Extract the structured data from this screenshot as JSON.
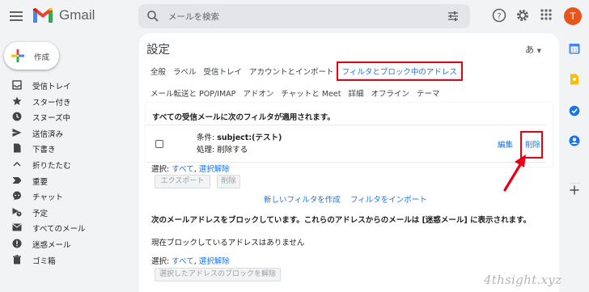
{
  "header": {
    "app_name": "Gmail",
    "search_placeholder": "メールを検索",
    "avatar_letter": "T"
  },
  "sidebar": {
    "compose_label": "作成",
    "items": [
      {
        "label": "受信トレイ",
        "icon": "inbox-icon"
      },
      {
        "label": "スター付き",
        "icon": "star-icon"
      },
      {
        "label": "スヌーズ中",
        "icon": "clock-icon"
      },
      {
        "label": "送信済み",
        "icon": "send-icon"
      },
      {
        "label": "下書き",
        "icon": "draft-icon"
      },
      {
        "label": "折りたたむ",
        "icon": "chevron-up-icon"
      },
      {
        "label": "重要",
        "icon": "important-icon"
      },
      {
        "label": "チャット",
        "icon": "chat-icon"
      },
      {
        "label": "予定",
        "icon": "scheduled-icon"
      },
      {
        "label": "すべてのメール",
        "icon": "all-mail-icon"
      },
      {
        "label": "迷惑メール",
        "icon": "spam-icon"
      },
      {
        "label": "ゴミ箱",
        "icon": "trash-icon"
      }
    ]
  },
  "settings": {
    "title": "設定",
    "input_tool": "あ",
    "tabs_row1": [
      "全般",
      "ラベル",
      "受信トレイ",
      "アカウントとインポート",
      "フィルタとブロック中のアドレス"
    ],
    "tabs_row2": [
      "メール転送と POP/IMAP",
      "アドオン",
      "チャットと Meet",
      "詳細",
      "オフライン",
      "テーマ"
    ],
    "filters_heading": "すべての受信メールに次のフィルタが適用されます。",
    "filter": {
      "condition_prefix": "条件: ",
      "condition_value": "subject:(テスト)",
      "action": "処理: 削除する",
      "edit": "編集",
      "delete": "削除"
    },
    "select_prefix": "選択: ",
    "select_all": "すべて",
    "select_sep": ", ",
    "select_none": "選択解除",
    "export_button": "エクスポート",
    "delete_button": "削除",
    "create_filter": "新しいフィルタを作成",
    "import_filter": "フィルタをインポート",
    "blocked_heading": "次のメールアドレスをブロックしています。これらのアドレスからのメールは [迷惑メール] に表示されます。",
    "no_blocked": "現在ブロックしているアドレスはありません",
    "unblock_button": "選択したアドレスのブロックを解除"
  },
  "watermark": "4thsight.xyz",
  "colors": {
    "accent": "#1a73e8",
    "highlight": "#e60012",
    "avatar": "#e8541d"
  }
}
